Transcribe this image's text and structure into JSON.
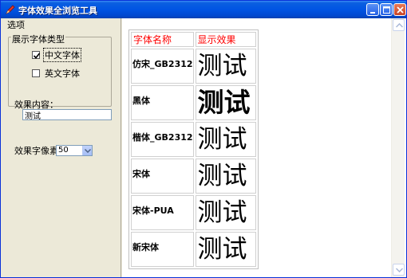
{
  "window": {
    "title": "字体效果全浏览工具"
  },
  "icons": {
    "app": "pen-icon",
    "minimize": "minimize-icon",
    "maximize": "maximize-icon",
    "close": "close-icon"
  },
  "left": {
    "options_label": "选项",
    "group_title": "展示字体类型",
    "chinese_font_label": "中文字体",
    "chinese_font_checked": true,
    "english_font_label": "英文字体",
    "english_font_checked": false,
    "content_label": "效果内容：",
    "content_value": "测试",
    "pixel_label": "效果字像素",
    "pixel_value": "50"
  },
  "table": {
    "headers": [
      "字体名称",
      "显示效果"
    ],
    "rows": [
      {
        "name": "仿宋_GB2312",
        "sample": "测试"
      },
      {
        "name": "黑体",
        "sample": "测试"
      },
      {
        "name": "楷体_GB2312",
        "sample": "测试"
      },
      {
        "name": "宋体",
        "sample": "测试"
      },
      {
        "name": "宋体-PUA",
        "sample": "测试"
      },
      {
        "name": "新宋体",
        "sample": "测试"
      }
    ]
  },
  "colors": {
    "titlebar": "#0054e3",
    "header_text": "#ff0000",
    "panel": "#ece9d8"
  }
}
